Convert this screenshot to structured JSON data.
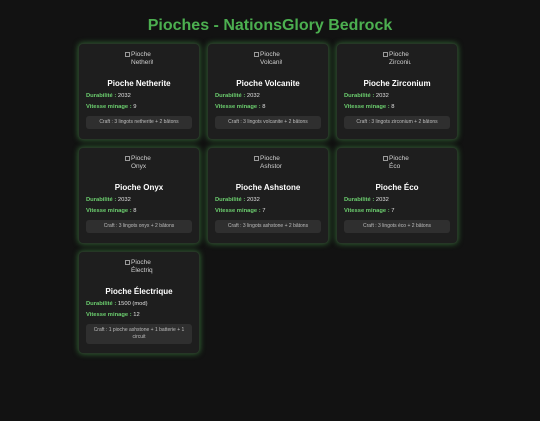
{
  "page": {
    "title": "Pioches - NationsGlory Bedrock"
  },
  "labels": {
    "durability": "Durabilité :",
    "speed": "Vitesse minage :"
  },
  "cards": [
    {
      "alt": "Pioche Netherite",
      "name": "Pioche Netherite",
      "durability": "2032",
      "speed": "9",
      "craft": "Craft : 3 lingots netherite + 2 bâtons"
    },
    {
      "alt": "Pioche Volcanite",
      "name": "Pioche Volcanite",
      "durability": "2032",
      "speed": "8",
      "craft": "Craft : 3 lingots volcanite + 2 bâtons"
    },
    {
      "alt": "Pioche Zirconium",
      "name": "Pioche Zirconium",
      "durability": "2032",
      "speed": "8",
      "craft": "Craft : 3 lingots zirconium + 2 bâtons"
    },
    {
      "alt": "Pioche Onyx",
      "name": "Pioche Onyx",
      "durability": "2032",
      "speed": "8",
      "craft": "Craft : 3 lingots onyx + 2 bâtons"
    },
    {
      "alt": "Pioche Ashstone",
      "name": "Pioche Ashstone",
      "durability": "2032",
      "speed": "7",
      "craft": "Craft : 3 lingots ashstone + 2 bâtons"
    },
    {
      "alt": "Pioche Éco",
      "name": "Pioche Éco",
      "durability": "2032",
      "speed": "7",
      "craft": "Craft : 3 lingots éco + 2 bâtons"
    },
    {
      "alt": "Pioche Électrique",
      "name": "Pioche Électrique",
      "durability": "1500 (mod)",
      "speed": "12",
      "craft": "Craft : 1 pioche ashstone + 1 batterie + 1 circuit"
    }
  ],
  "colors": {
    "accent": "#4caf50",
    "background": "#121212",
    "card": "#1e1e1e"
  }
}
